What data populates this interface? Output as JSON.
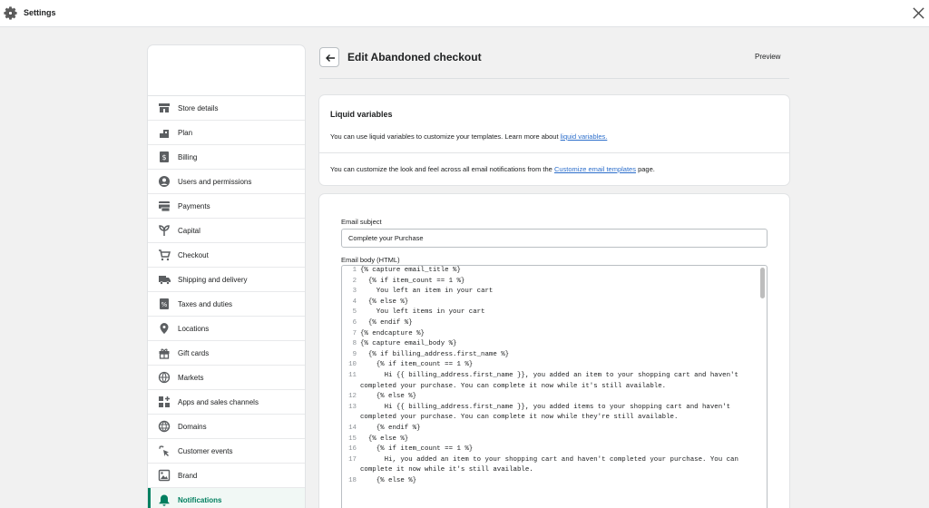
{
  "topbar": {
    "title": "Settings",
    "settings_icon": "gear-icon",
    "close_icon": "close-icon"
  },
  "sidebar": {
    "items": [
      {
        "label": "Store details",
        "icon": "store-icon"
      },
      {
        "label": "Plan",
        "icon": "plan-icon"
      },
      {
        "label": "Billing",
        "icon": "billing-icon"
      },
      {
        "label": "Users and permissions",
        "icon": "user-icon"
      },
      {
        "label": "Payments",
        "icon": "payments-icon"
      },
      {
        "label": "Capital",
        "icon": "capital-icon"
      },
      {
        "label": "Checkout",
        "icon": "cart-icon"
      },
      {
        "label": "Shipping and delivery",
        "icon": "truck-icon"
      },
      {
        "label": "Taxes and duties",
        "icon": "tax-icon"
      },
      {
        "label": "Locations",
        "icon": "location-icon"
      },
      {
        "label": "Gift cards",
        "icon": "gift-icon"
      },
      {
        "label": "Markets",
        "icon": "globe-icon"
      },
      {
        "label": "Apps and sales channels",
        "icon": "apps-icon"
      },
      {
        "label": "Domains",
        "icon": "domains-icon"
      },
      {
        "label": "Customer events",
        "icon": "cursor-icon"
      },
      {
        "label": "Brand",
        "icon": "brand-icon"
      },
      {
        "label": "Notifications",
        "icon": "bell-icon",
        "active": true
      }
    ]
  },
  "header": {
    "title": "Edit Abandoned checkout",
    "preview_label": "Preview",
    "back_icon": "arrow-left-icon"
  },
  "liquid_card": {
    "title": "Liquid variables",
    "text1_prefix": "You can use liquid variables to customize your templates. Learn more about ",
    "text1_link": "liquid variables.",
    "text2_prefix": "You can customize the look and feel across all email notifications from the ",
    "text2_link": "Customize email templates",
    "text2_suffix": " page."
  },
  "email_card": {
    "subject_label": "Email subject",
    "subject_value": "Complete your Purchase",
    "body_label": "Email body (HTML)",
    "code_lines": [
      {
        "n": "1",
        "code": "{% capture email_title %}"
      },
      {
        "n": "2",
        "code": "  {% if item_count == 1 %}"
      },
      {
        "n": "3",
        "code": "    You left an item in your cart"
      },
      {
        "n": "4",
        "code": "  {% else %}"
      },
      {
        "n": "5",
        "code": "    You left items in your cart"
      },
      {
        "n": "6",
        "code": "  {% endif %}"
      },
      {
        "n": "7",
        "code": "{% endcapture %}"
      },
      {
        "n": "8",
        "code": "{% capture email_body %}"
      },
      {
        "n": "9",
        "code": "  {% if billing_address.first_name %}"
      },
      {
        "n": "10",
        "code": "    {% if item_count == 1 %}"
      },
      {
        "n": "11",
        "code": "      Hi {{ billing_address.first_name }}, you added an item to your shopping cart and haven't completed your purchase. You can complete it now while it's still available."
      },
      {
        "n": "12",
        "code": "    {% else %}"
      },
      {
        "n": "13",
        "code": "      Hi {{ billing_address.first_name }}, you added items to your shopping cart and haven't completed your purchase. You can complete it now while they're still available."
      },
      {
        "n": "14",
        "code": "    {% endif %}"
      },
      {
        "n": "15",
        "code": "  {% else %}"
      },
      {
        "n": "16",
        "code": "    {% if item_count == 1 %}"
      },
      {
        "n": "17",
        "code": "      Hi, you added an item to your shopping cart and haven't completed your purchase. You can complete it now while it's still available."
      },
      {
        "n": "18",
        "code": "    {% else %}"
      }
    ]
  },
  "colors": {
    "accent": "#008060",
    "link": "#2c6ecb"
  }
}
